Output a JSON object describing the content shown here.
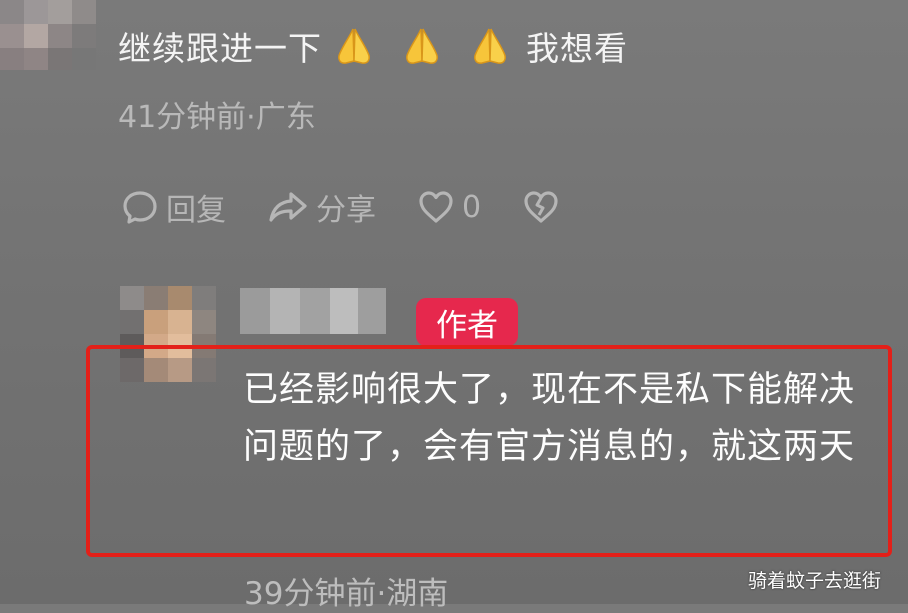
{
  "comment1": {
    "text_before": "继续跟进一下",
    "emoji_name": "folded-hands-emoji",
    "text_after": "我想看",
    "meta": "41分钟前·广东"
  },
  "actions": {
    "reply_icon": "comment-bubble-icon",
    "reply_label": "回复",
    "share_icon": "share-arrow-icon",
    "share_label": "分享",
    "like_icon": "heart-icon",
    "like_count": "0",
    "dislike_icon": "broken-heart-icon"
  },
  "reply": {
    "badge": "作者",
    "text": "已经影响很大了，现在不是私下能解决问题的了，会有官方消息的，就这两天",
    "meta": "39分钟前·湖南",
    "highlight_color": "#e32019"
  },
  "watermark": {
    "line1": "骑着蚊子去逛街"
  },
  "colors": {
    "badge": "#e6284d",
    "background": "#737373"
  }
}
